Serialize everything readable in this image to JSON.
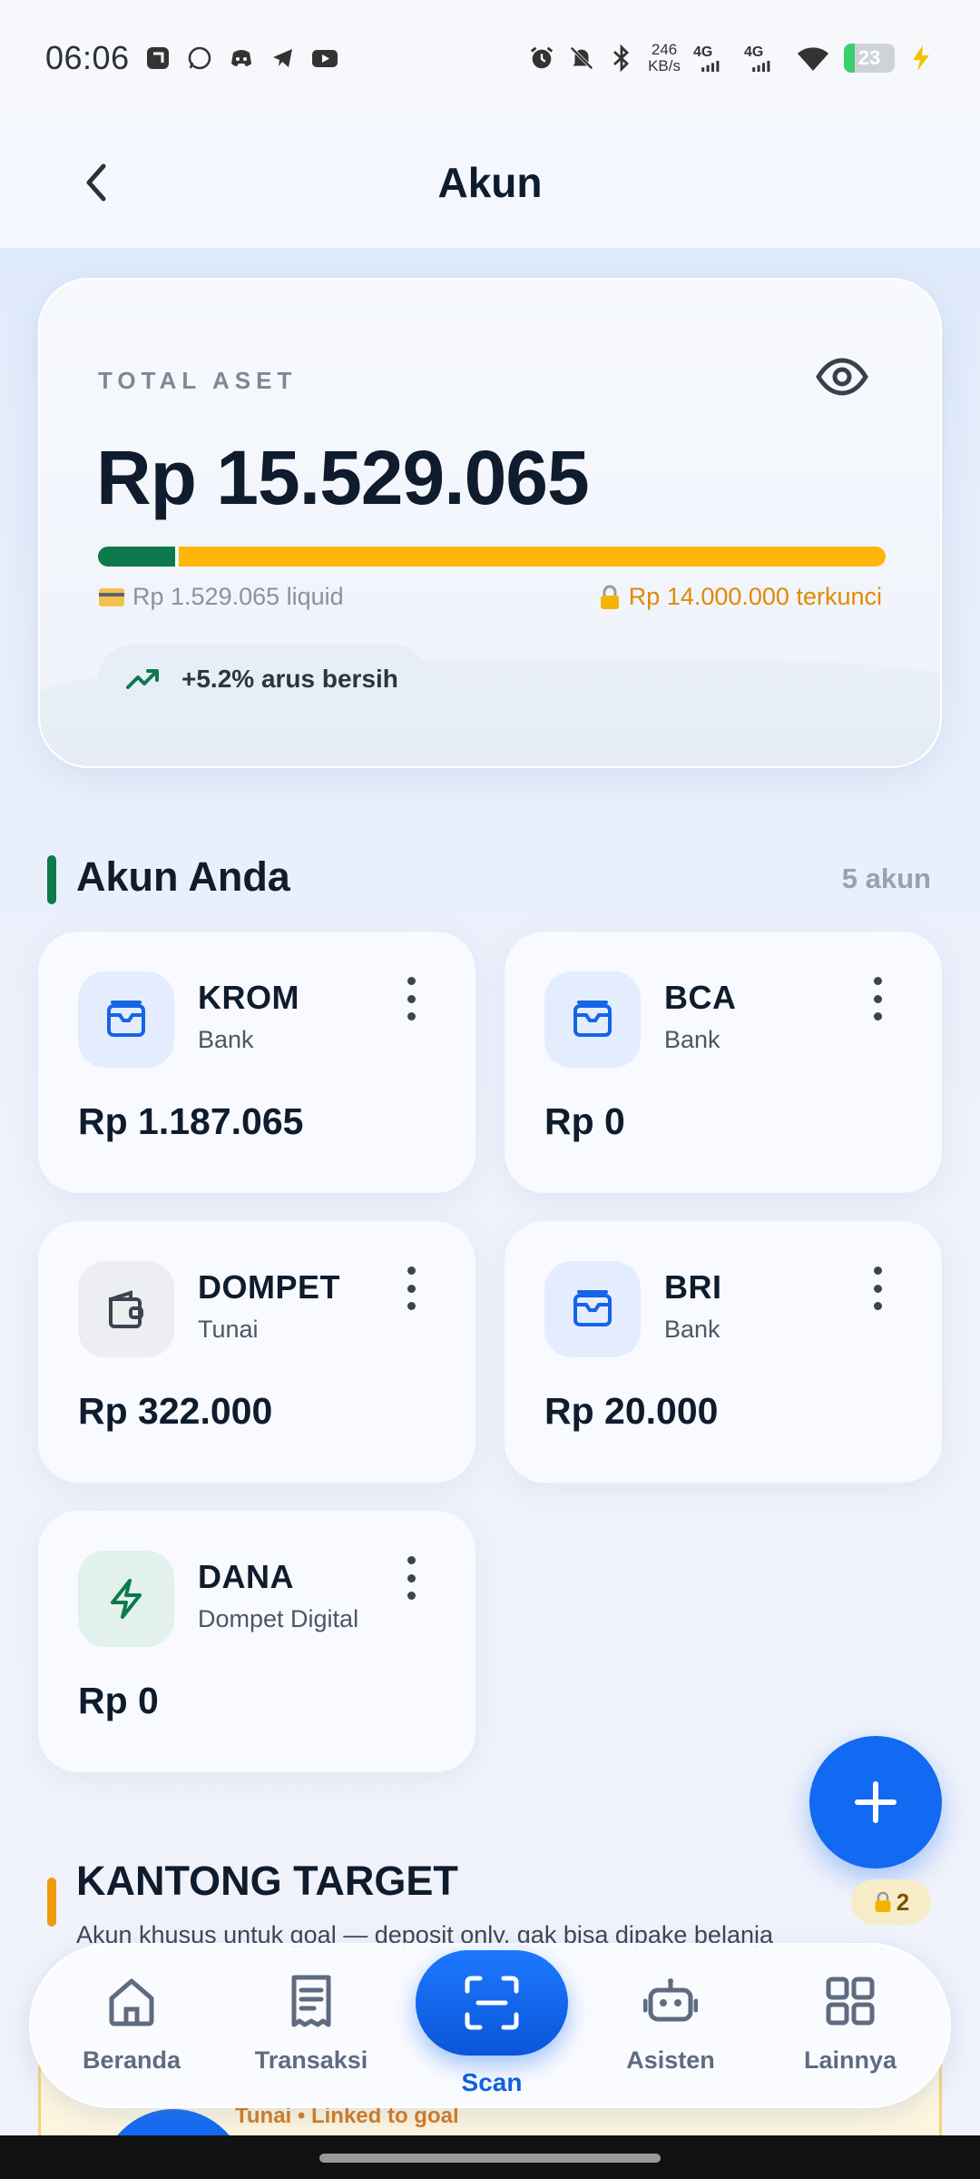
{
  "status_bar": {
    "time": "06:06",
    "speed_top": "246",
    "speed_bottom": "KB/s",
    "net1": "4G",
    "net2": "4G",
    "battery": "23"
  },
  "header": {
    "title": "Akun"
  },
  "summary": {
    "label": "TOTAL ASET",
    "total": "Rp 15.529.065",
    "liquid_fraction": 0.098,
    "liquid_text": "Rp 1.529.065 liquid",
    "locked_text": "Rp 14.000.000 terkunci",
    "flow_text": "+5.2% arus bersih"
  },
  "accounts_section": {
    "title": "Akun Anda",
    "count": "5 akun",
    "items": [
      {
        "name": "KROM",
        "type": "Bank",
        "balance": "Rp 1.187.065",
        "icon": "bank-icon"
      },
      {
        "name": "BCA",
        "type": "Bank",
        "balance": "Rp 0",
        "icon": "bank-icon"
      },
      {
        "name": "DOMPET",
        "type": "Tunai",
        "balance": "Rp 322.000",
        "icon": "wallet-icon"
      },
      {
        "name": "BRI",
        "type": "Bank",
        "balance": "Rp 20.000",
        "icon": "bank-icon"
      },
      {
        "name": "DANA",
        "type": "Dompet Digital",
        "balance": "Rp 0",
        "icon": "lightning-icon"
      }
    ]
  },
  "target_section": {
    "title": "KANTONG TARGET",
    "badge_count": "2",
    "description": "Akun khusus untuk goal — deposit only, gak bisa dipake belanja",
    "peek_text": "Tunai • Linked to goal"
  },
  "bottom_nav": {
    "items": [
      {
        "label": "Beranda"
      },
      {
        "label": "Transaksi"
      },
      {
        "label": "Scan"
      },
      {
        "label": "Asisten"
      },
      {
        "label": "Lainnya"
      }
    ]
  },
  "colors": {
    "primary": "#1269f2",
    "liquid_green": "#0d7a4e",
    "locked_amber": "#ffb60a",
    "bank_icon_bg": "#e4edfd",
    "wallet_icon_bg": "#eceef1",
    "dana_icon_bg": "#e2f1ec"
  }
}
